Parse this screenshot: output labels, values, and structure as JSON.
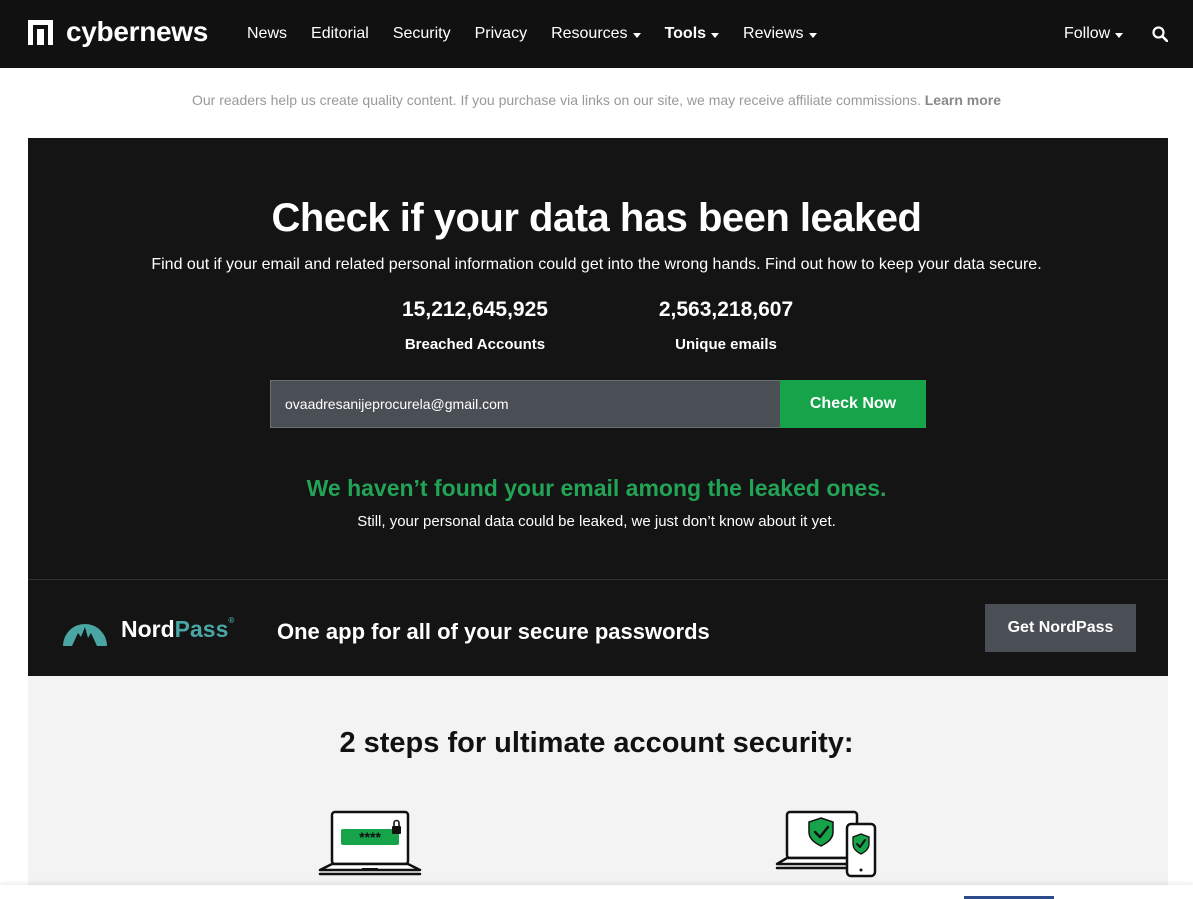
{
  "header": {
    "logo_text": "cybernews",
    "nav": [
      {
        "label": "News",
        "dropdown": false,
        "bold": false
      },
      {
        "label": "Editorial",
        "dropdown": false,
        "bold": false
      },
      {
        "label": "Security",
        "dropdown": false,
        "bold": false
      },
      {
        "label": "Privacy",
        "dropdown": false,
        "bold": false
      },
      {
        "label": "Resources",
        "dropdown": true,
        "bold": false
      },
      {
        "label": "Tools",
        "dropdown": true,
        "bold": true
      },
      {
        "label": "Reviews",
        "dropdown": true,
        "bold": false
      }
    ],
    "follow_label": "Follow",
    "search_icon": "search-icon"
  },
  "disclaimer": {
    "text": "Our readers help us create quality content. If you purchase via links on our site, we may receive affiliate commissions.",
    "link": "Learn more"
  },
  "hero": {
    "title": "Check if your data has been leaked",
    "subtitle": "Find out if your email and related personal information could get into the wrong hands. Find out how to keep your data secure.",
    "stats": [
      {
        "value": "15,212,645,925",
        "label": "Breached Accounts"
      },
      {
        "value": "2,563,218,607",
        "label": "Unique emails"
      }
    ],
    "email_value": "ovaadresanijeprocurela@gmail.com",
    "check_button": "Check Now",
    "result_title": "We haven’t found your email among the leaked ones.",
    "result_sub": "Still, your personal data could be leaked, we just don’t know about it yet."
  },
  "promo": {
    "brand_left": "Nord",
    "brand_right": "Pass",
    "brand_mark": "®",
    "tagline": "One app for all of your secure passwords",
    "button": "Get NordPass"
  },
  "steps": {
    "title": "2 steps for ultimate account security:",
    "icons": [
      "laptop-password-icon",
      "devices-shield-icon"
    ],
    "password_mask": "****"
  },
  "colors": {
    "nav_bg": "#111111",
    "hero_bg": "#141414",
    "accent_green": "#16a34a",
    "result_green": "#22a355",
    "nordpass_teal": "#4aa6a4",
    "button_gray": "#4a4f56"
  }
}
